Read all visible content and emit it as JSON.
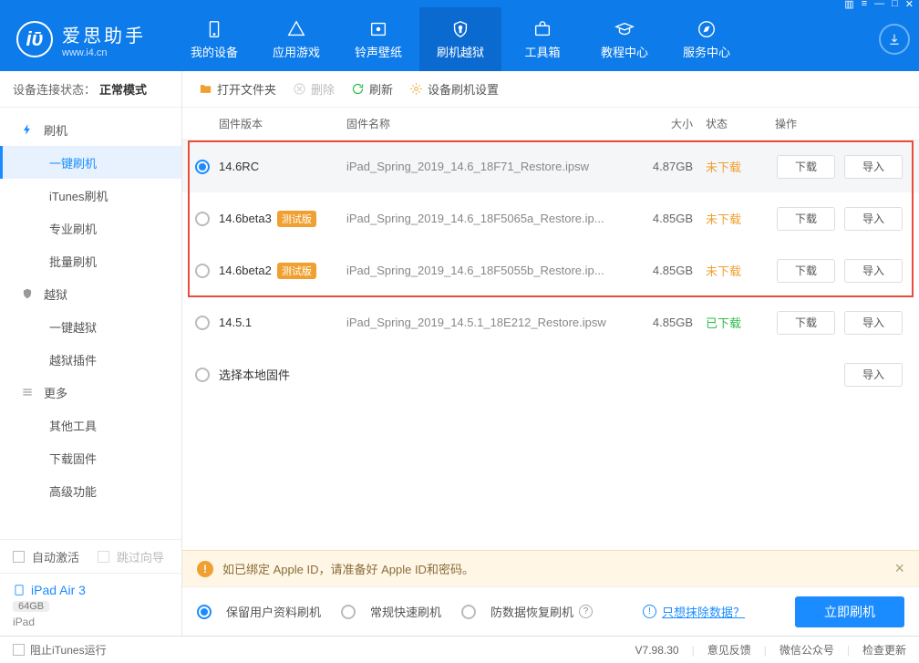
{
  "app": {
    "title": "爱思助手",
    "subtitle": "www.i4.cn"
  },
  "nav": {
    "items": [
      {
        "label": "我的设备"
      },
      {
        "label": "应用游戏"
      },
      {
        "label": "铃声壁纸"
      },
      {
        "label": "刷机越狱"
      },
      {
        "label": "工具箱"
      },
      {
        "label": "教程中心"
      },
      {
        "label": "服务中心"
      }
    ]
  },
  "sidebar": {
    "status_label": "设备连接状态：",
    "status_value": "正常模式",
    "groups": {
      "flash": {
        "title": "刷机",
        "items": [
          "一键刷机",
          "iTunes刷机",
          "专业刷机",
          "批量刷机"
        ]
      },
      "jailbreak": {
        "title": "越狱",
        "items": [
          "一键越狱",
          "越狱插件"
        ]
      },
      "more": {
        "title": "更多",
        "items": [
          "其他工具",
          "下载固件",
          "高级功能"
        ]
      }
    },
    "auto_activate": "自动激活",
    "skip_guide": "跳过向导",
    "device": {
      "name": "iPad Air 3",
      "capacity": "64GB",
      "type": "iPad"
    }
  },
  "toolbar": {
    "open": "打开文件夹",
    "delete": "删除",
    "refresh": "刷新",
    "settings": "设备刷机设置"
  },
  "table": {
    "headers": {
      "version": "固件版本",
      "name": "固件名称",
      "size": "大小",
      "status": "状态",
      "action": "操作"
    },
    "status_no": "未下载",
    "status_yes": "已下载",
    "beta_tag": "测试版",
    "btn_download": "下载",
    "btn_import": "导入",
    "local_firmware": "选择本地固件",
    "rows": [
      {
        "version": "14.6RC",
        "beta": false,
        "name": "iPad_Spring_2019_14.6_18F71_Restore.ipsw",
        "size": "4.87GB",
        "downloaded": false
      },
      {
        "version": "14.6beta3",
        "beta": true,
        "name": "iPad_Spring_2019_14.6_18F5065a_Restore.ip...",
        "size": "4.85GB",
        "downloaded": false
      },
      {
        "version": "14.6beta2",
        "beta": true,
        "name": "iPad_Spring_2019_14.6_18F5055b_Restore.ip...",
        "size": "4.85GB",
        "downloaded": false
      },
      {
        "version": "14.5.1",
        "beta": false,
        "name": "iPad_Spring_2019_14.5.1_18E212_Restore.ipsw",
        "size": "4.85GB",
        "downloaded": true
      }
    ]
  },
  "warning": "如已绑定 Apple ID，请准备好 Apple ID和密码。",
  "options": {
    "keep_data": "保留用户资料刷机",
    "normal": "常规快速刷机",
    "anti_recovery": "防数据恢复刷机",
    "erase_only": "只想抹除数据？",
    "start": "立即刷机"
  },
  "footer": {
    "block_itunes": "阻止iTunes运行",
    "version": "V7.98.30",
    "feedback": "意见反馈",
    "wechat": "微信公众号",
    "check_update": "检查更新"
  }
}
